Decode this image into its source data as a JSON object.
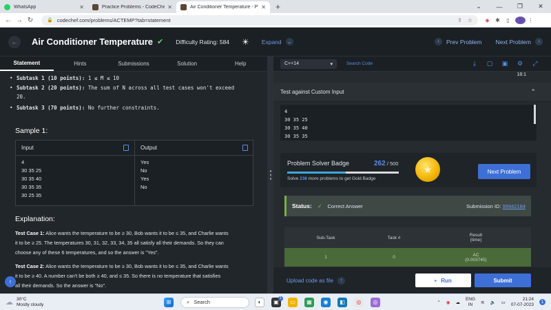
{
  "browser": {
    "tabs": [
      {
        "title": "WhatsApp",
        "fav": "#25d366"
      },
      {
        "title": "Practice Problems - CodeChef",
        "fav": "#5b4636"
      },
      {
        "title": "Air Conditioner Temperature - P…",
        "fav": "#5b4636"
      }
    ],
    "url": "codechef.com/problems/ACTEMP?tab=statement"
  },
  "header": {
    "title": "Air Conditioner Temperature",
    "difficulty": "Difficulty Rating: 584",
    "expand": "Expand",
    "prev": "Prev Problem",
    "next": "Next Problem"
  },
  "left_tabs": [
    "Statement",
    "Hints",
    "Submissions",
    "Solution",
    "Help"
  ],
  "statement": {
    "subtasks": [
      {
        "label": "Subtask 1 (10 points):",
        "text": "1 ≤ M ≤ 10"
      },
      {
        "label": "Subtask 2 (20 points):",
        "text": "The sum of N across all test cases won't exceed"
      },
      {
        "label": "",
        "text": "20."
      },
      {
        "label": "Subtask 3 (70 points):",
        "text": "No further constraints."
      }
    ],
    "sample_heading": "Sample 1:",
    "input_header": "Input",
    "output_header": "Output",
    "input_lines": [
      "4",
      "30 35 25",
      "30 35 40",
      "30 35 35",
      "30 25 35"
    ],
    "output_lines": [
      "Yes",
      "No",
      "Yes",
      "No"
    ],
    "explanation_heading": "Explanation:",
    "tc1_label": "Test Case 1:",
    "tc1_l1": "Alice wants the temperature to be ≥ 30, Bob wants it to be ≤ 35, and Charlie wants",
    "tc1_l2": "it to be ≥ 25. The temperatures 30, 31, 32, 33, 34, 35 all satisfy all their demands. So they can",
    "tc1_l3": "choose any of these 6 temperatures, and so the answer is \"Yes\".",
    "tc2_label": "Test Case 2:",
    "tc2_l1": "Alice wants the temperature to be ≥ 30, Bob wants it to be ≤ 35, and Charlie wants",
    "tc2_l2": "it to be ≥ 40. A number can't be both ≥ 40, and ≤ 35. So there is no temperature that satisfies",
    "tc2_l3": "all their demands. So the answer is \"No\"."
  },
  "editor": {
    "language": "C++14",
    "search": "Search Code",
    "cursor": "18:1"
  },
  "custom_input": {
    "title": "Test against Custom Input",
    "lines": [
      "4",
      "30 35 25",
      "30 35 40",
      "30 35 35"
    ]
  },
  "badge": {
    "title": "Problem Solver Badge",
    "count": "262",
    "total": "/ 500",
    "progress": 0.524,
    "solve_prefix": "Solve",
    "solve_count": "238",
    "solve_suffix": "more problems to get Gold Badge",
    "next_button": "Next Problem"
  },
  "status": {
    "label": "Status:",
    "value": "Correct Answer",
    "sid_label": "Submission ID:",
    "sid": "99942184"
  },
  "results": {
    "headers": [
      "Sub-Task",
      "Task #",
      "Result"
    ],
    "result_sub": "(time)",
    "rows": [
      {
        "subtask": "1",
        "task": "0",
        "result": "AC",
        "time": "(0.003745)"
      }
    ]
  },
  "actions": {
    "upload": "Upload code as file",
    "run": "Run",
    "submit": "Submit"
  },
  "taskbar": {
    "temp": "30°C",
    "weather": "Mostly cloudy",
    "search": "Search",
    "lang1": "ENG",
    "lang2": "IN",
    "time": "21:24",
    "date": "07-07-2023"
  }
}
